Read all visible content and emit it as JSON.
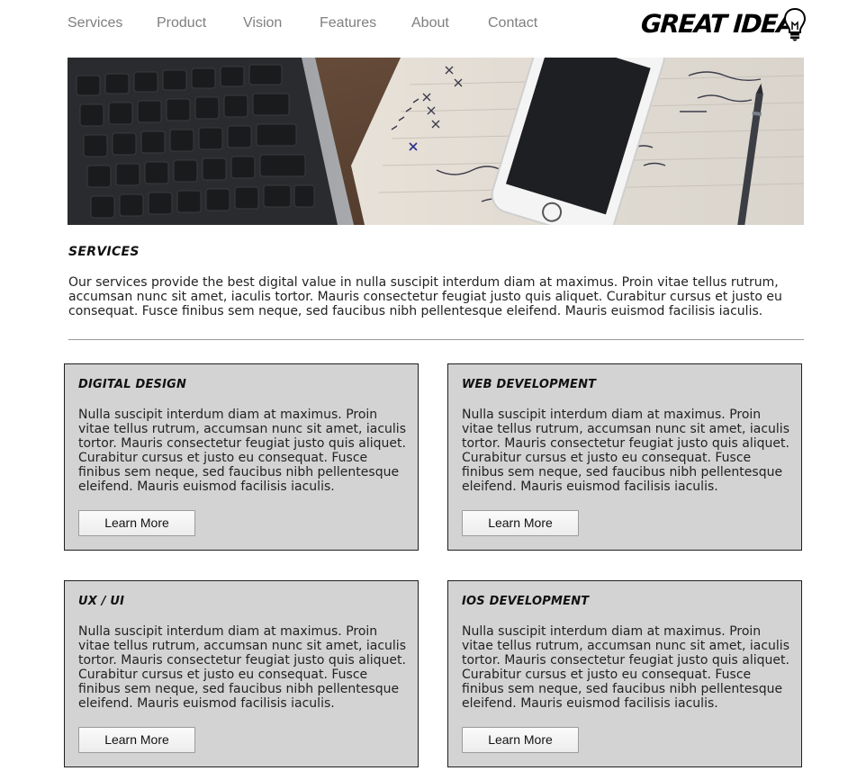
{
  "nav": {
    "items": [
      {
        "label": "Services"
      },
      {
        "label": "Product"
      },
      {
        "label": "Vision"
      },
      {
        "label": "Features"
      },
      {
        "label": "About"
      },
      {
        "label": "Contact"
      }
    ]
  },
  "logo": {
    "text": "GREAT IDEA",
    "icon": "lightbulb-icon"
  },
  "hero": {
    "image": "laptop-notebook-phone-photo"
  },
  "services": {
    "title": "SERVICES",
    "intro": "Our services provide the best digital value in nulla suscipit interdum diam at maximus. Proin vitae tellus rutrum, accumsan nunc sit amet, iaculis tortor. Mauris consectetur feugiat justo quis aliquet. Curabitur cursus et justo eu consequat. Fusce finibus sem neque, sed faucibus nibh pellentesque eleifend. Mauris euismod facilisis iaculis."
  },
  "cards": [
    {
      "title": "DIGITAL DESIGN",
      "body": "Nulla suscipit interdum diam at maximus. Proin vitae tellus rutrum, accumsan nunc sit amet, iaculis tortor. Mauris consectetur feugiat justo quis aliquet. Curabitur cursus et justo eu consequat. Fusce finibus sem neque, sed faucibus nibh pellentesque eleifend. Mauris euismod facilisis iaculis.",
      "button": "Learn More"
    },
    {
      "title": "WEB DEVELOPMENT",
      "body": "Nulla suscipit interdum diam at maximus. Proin vitae tellus rutrum, accumsan nunc sit amet, iaculis tortor. Mauris consectetur feugiat justo quis aliquet. Curabitur cursus et justo eu consequat. Fusce finibus sem neque, sed faucibus nibh pellentesque eleifend. Mauris euismod facilisis iaculis.",
      "button": "Learn More"
    },
    {
      "title": "UX / UI",
      "body": "Nulla suscipit interdum diam at maximus. Proin vitae tellus rutrum, accumsan nunc sit amet, iaculis tortor. Mauris consectetur feugiat justo quis aliquet. Curabitur cursus et justo eu consequat. Fusce finibus sem neque, sed faucibus nibh pellentesque eleifend. Mauris euismod facilisis iaculis.",
      "button": "Learn More"
    },
    {
      "title": "IOS DEVELOPMENT",
      "body": "Nulla suscipit interdum diam at maximus. Proin vitae tellus rutrum, accumsan nunc sit amet, iaculis tortor. Mauris consectetur feugiat justo quis aliquet. Curabitur cursus et justo eu consequat. Fusce finibus sem neque, sed faucibus nibh pellentesque eleifend. Mauris euismod facilisis iaculis.",
      "button": "Learn More"
    }
  ],
  "colors": {
    "nav_text": "#7f7f7f",
    "card_bg": "#d3d3d3",
    "card_border": "#1f1f1f",
    "divider": "#9a9a9a"
  }
}
